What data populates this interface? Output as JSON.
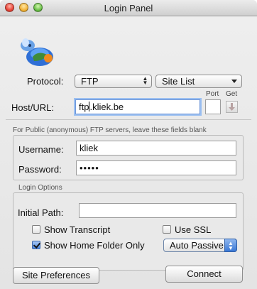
{
  "window": {
    "title": "Login Panel"
  },
  "protocol": {
    "label": "Protocol:",
    "value": "FTP",
    "site_list": "Site List"
  },
  "host": {
    "label": "Host/URL:",
    "value_before_cursor": "ftp",
    "value_after_cursor": ".kliek.be",
    "port_label": "Port",
    "get_label": "Get",
    "port_value": ""
  },
  "note": "For Public (anonymous) FTP servers, leave these fields blank",
  "credentials": {
    "username_label": "Username:",
    "username_value": "kliek",
    "password_label": "Password:",
    "password_value": "•••••"
  },
  "login_options": {
    "header": "Login Options",
    "initial_path_label": "Initial Path:",
    "initial_path_value": "",
    "show_transcript": "Show Transcript",
    "use_ssl": "Use SSL",
    "show_home_folder_only": "Show Home Folder Only",
    "passive_mode": "Auto Passive"
  },
  "buttons": {
    "site_preferences": "Site Preferences",
    "connect": "Connect"
  },
  "icons": {
    "logo": "fetch-dog-globe-icon",
    "get": "download-arrow-icon"
  }
}
